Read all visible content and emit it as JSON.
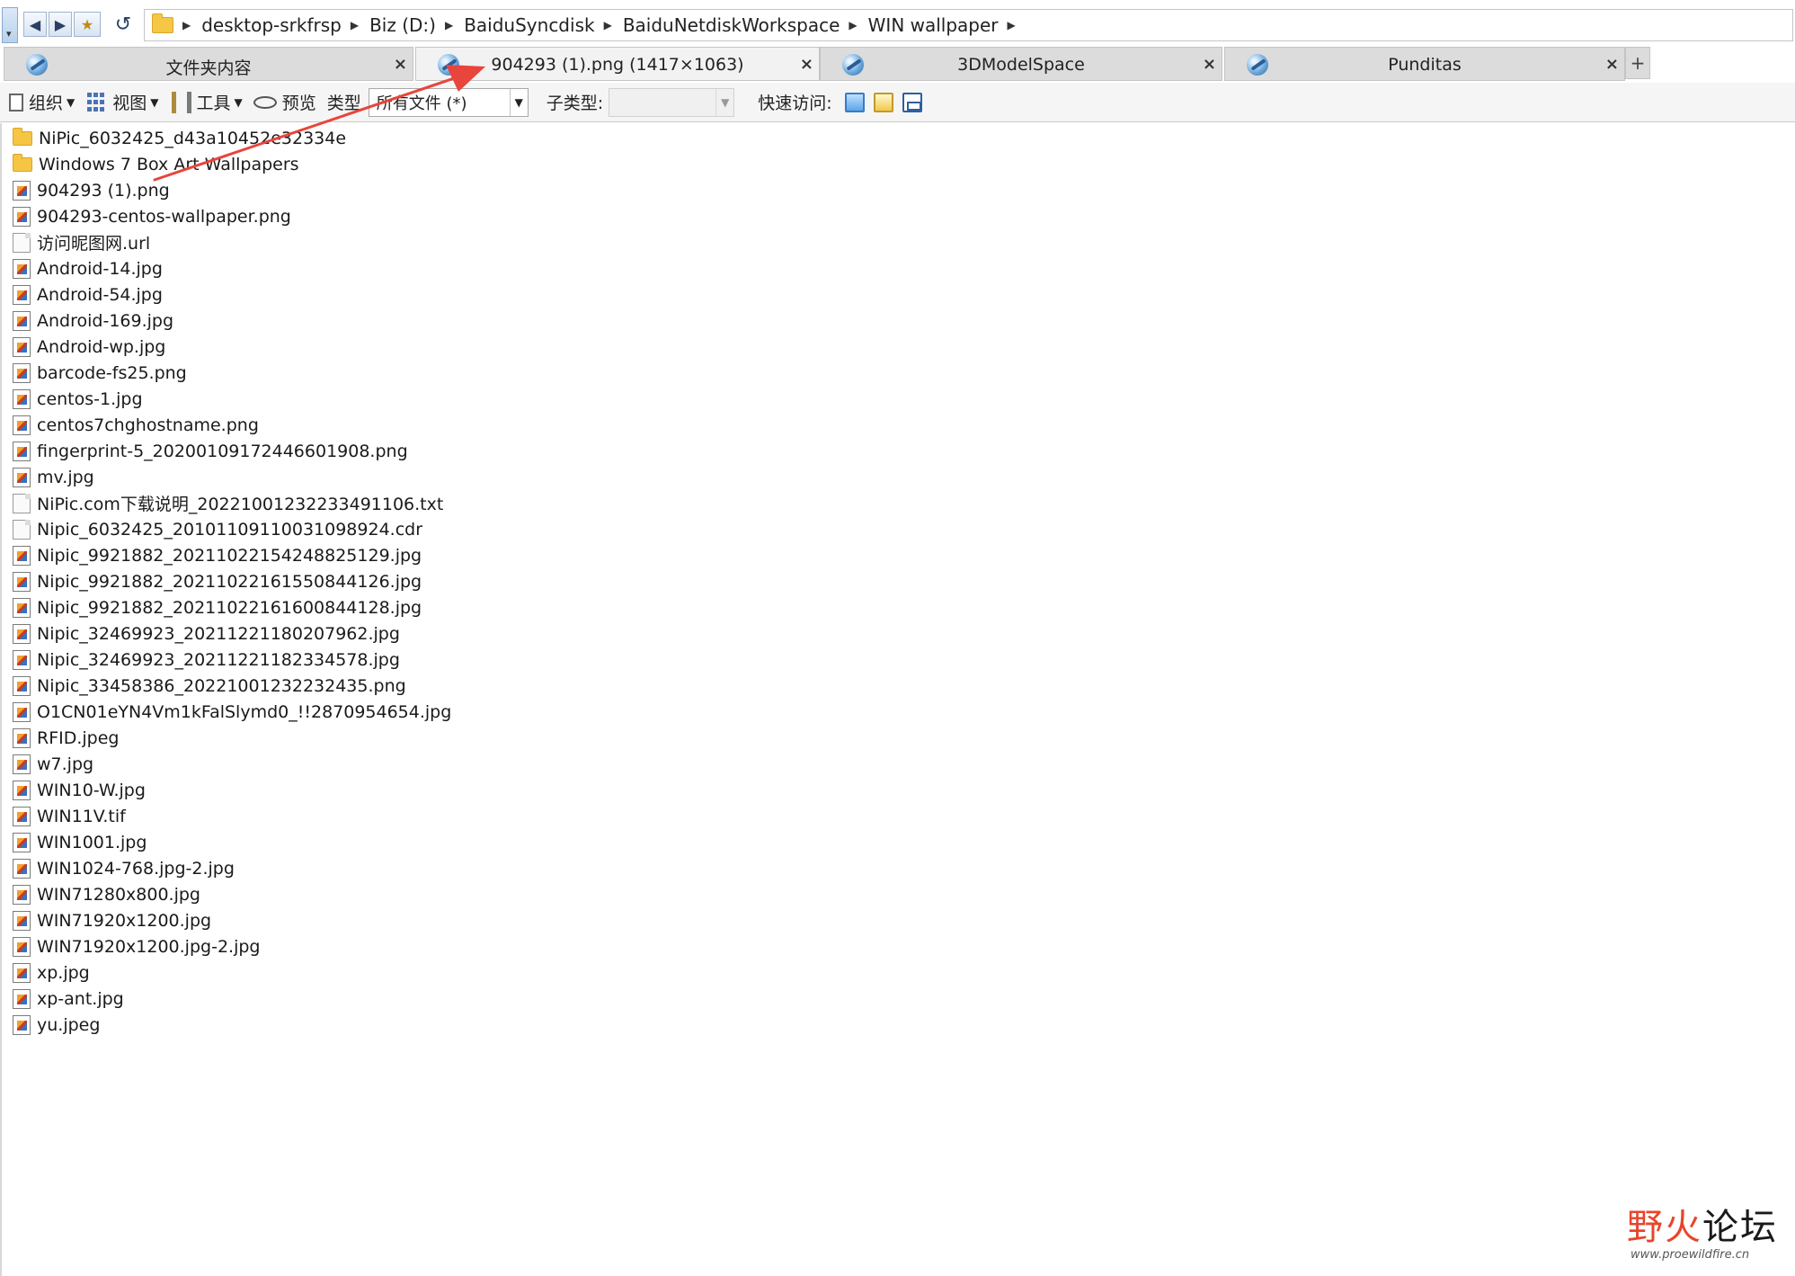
{
  "address": {
    "crumbs": [
      "desktop-srkfrsp",
      "Biz (D:)",
      "BaiduSyncdisk",
      "BaiduNetdiskWorkspace",
      "WIN wallpaper"
    ]
  },
  "tabs": [
    {
      "label": "文件夹内容",
      "active": false
    },
    {
      "label": "904293 (1).png (1417×1063)",
      "active": true
    },
    {
      "label": "3DModelSpace",
      "active": false
    },
    {
      "label": "Punditas",
      "active": false
    }
  ],
  "tab_add_label": "+",
  "tab_close_label": "×",
  "toolbar": {
    "organize": "组织",
    "view": "视图",
    "tools": "工具",
    "preview": "预览",
    "type_label": "类型",
    "type_value": "所有文件 (*)",
    "subtype_label": "子类型:",
    "quick_access": "快速访问:"
  },
  "files": [
    {
      "name": "NiPic_6032425_d43a10452e32334e",
      "kind": "folder"
    },
    {
      "name": "Windows 7 Box Art Wallpapers",
      "kind": "folder"
    },
    {
      "name": "904293 (1).png",
      "kind": "image"
    },
    {
      "name": "904293-centos-wallpaper.png",
      "kind": "image"
    },
    {
      "name": "访问昵图网.url",
      "kind": "doc"
    },
    {
      "name": "Android-14.jpg",
      "kind": "image"
    },
    {
      "name": "Android-54.jpg",
      "kind": "image"
    },
    {
      "name": "Android-169.jpg",
      "kind": "image"
    },
    {
      "name": "Android-wp.jpg",
      "kind": "image"
    },
    {
      "name": "barcode-fs25.png",
      "kind": "image"
    },
    {
      "name": "centos-1.jpg",
      "kind": "image"
    },
    {
      "name": "centos7chghostname.png",
      "kind": "image"
    },
    {
      "name": "fingerprint-5_20200109172446601908.png",
      "kind": "image"
    },
    {
      "name": "mv.jpg",
      "kind": "image"
    },
    {
      "name": "NiPic.com下载说明_20221001232233491106.txt",
      "kind": "doc"
    },
    {
      "name": "Nipic_6032425_20101109110031098924.cdr",
      "kind": "doc"
    },
    {
      "name": "Nipic_9921882_20211022154248825129.jpg",
      "kind": "image"
    },
    {
      "name": "Nipic_9921882_20211022161550844126.jpg",
      "kind": "image"
    },
    {
      "name": "Nipic_9921882_20211022161600844128.jpg",
      "kind": "image"
    },
    {
      "name": "Nipic_32469923_20211221180207962.jpg",
      "kind": "image"
    },
    {
      "name": "Nipic_32469923_20211221182334578.jpg",
      "kind": "image"
    },
    {
      "name": "Nipic_33458386_20221001232232435.png",
      "kind": "image"
    },
    {
      "name": "O1CN01eYN4Vm1kFalSlymd0_!!2870954654.jpg",
      "kind": "image"
    },
    {
      "name": "RFID.jpeg",
      "kind": "image"
    },
    {
      "name": "w7.jpg",
      "kind": "image"
    },
    {
      "name": "WIN10-W.jpg",
      "kind": "image"
    },
    {
      "name": "WIN11V.tif",
      "kind": "image"
    },
    {
      "name": "WIN1001.jpg",
      "kind": "image"
    },
    {
      "name": "WIN1024-768.jpg-2.jpg",
      "kind": "image"
    },
    {
      "name": "WIN71280x800.jpg",
      "kind": "image"
    },
    {
      "name": "WIN71920x1200.jpg",
      "kind": "image"
    },
    {
      "name": "WIN71920x1200.jpg-2.jpg",
      "kind": "image"
    },
    {
      "name": "xp.jpg",
      "kind": "image"
    },
    {
      "name": "xp-ant.jpg",
      "kind": "image"
    },
    {
      "name": "yu.jpeg",
      "kind": "image"
    }
  ],
  "annotation_arrow_color": "#e8453c",
  "watermark": {
    "cn_red": "野火",
    "cn_black": "论坛",
    "url": "www.proewildfire.cn"
  }
}
